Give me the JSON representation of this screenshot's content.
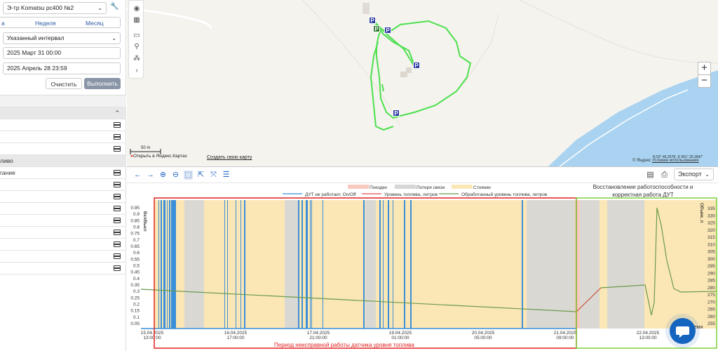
{
  "sidebar": {
    "unit_select": "Э-тр Komatsu pc400 №2",
    "tabs": [
      "а",
      "Неделя",
      "Месяц"
    ],
    "interval_select": "Указанный интервал",
    "date_from": "2025 Март 31 00:00",
    "date_to": "2025 Апрель 28 23:59",
    "clear_label": "Очистить",
    "run_label": "Выполнить",
    "rows": [
      "",
      "",
      "",
      "",
      "",
      "ливо",
      "гание",
      "",
      "",
      "",
      "",
      "",
      "",
      "",
      ""
    ]
  },
  "map": {
    "scale_label": "50 m",
    "open_yandex": "Открыть в Яндекс.Картах",
    "create_map": "Создать свою карту",
    "coords": "N 52° 46.2578', E 051° 25.3647'",
    "copyright": "© Яндекс",
    "terms": "Условия использования",
    "zoom_in": "+",
    "zoom_out": "−",
    "parking_marks": [
      "P",
      "P",
      "P",
      "P",
      "P"
    ]
  },
  "chart_toolbar": {
    "export_label": "Экспорт"
  },
  "chart_data": {
    "type": "line",
    "legend_top": [
      "Поездки",
      "Потеря связи",
      "Стоянки"
    ],
    "legend_bottom": [
      "ДУТ не работает, On/Off",
      "Уровень топлива, литров",
      "Обработанный уровень топлива, литров"
    ],
    "colors": {
      "trips": "#f7c9bf",
      "lost": "#d6d6d6",
      "stops": "#fbe7b6",
      "dut": "#3a8fd9",
      "fuel": "#6a9a4a",
      "fuel_raw": "#e05050"
    },
    "y_left_label": "Вкл/Выкл",
    "y_left_ticks": [
      "0.95",
      "0.9",
      "0.85",
      "0.8",
      "0.75",
      "0.7",
      "0.65",
      "0.6",
      "0.55",
      "0.5",
      "0.45",
      "0.4",
      "0.35",
      "0.3",
      "0.25",
      "0.2",
      "0.15",
      "0.1",
      "0.05"
    ],
    "y_right_label": "Объем, л",
    "y_right_ticks": [
      "335",
      "330",
      "325",
      "320",
      "315",
      "310",
      "305",
      "300",
      "295",
      "290",
      "285",
      "280",
      "275",
      "270",
      "265",
      "260",
      "255"
    ],
    "x_ticks": [
      {
        "date": "15.04.2025",
        "time": "13:00:00"
      },
      {
        "date": "16.04.2025",
        "time": "17:00:00"
      },
      {
        "date": "17.04.2025",
        "time": "21:00:00"
      },
      {
        "date": "19.04.2025",
        "time": "01:00:00"
      },
      {
        "date": "20.04.2025",
        "time": "05:00:00"
      },
      {
        "date": "21.04.2025",
        "time": "09:00:00"
      },
      {
        "date": "22.04.2025",
        "time": "13:00:00"
      }
    ],
    "x_axis_tail": "ремя",
    "annotation_faulty": "Период неисправной работы датчика уровня топлива",
    "annotation_recovery": [
      "Восстановление работоспособности и",
      "корректная работа ДУТ"
    ]
  }
}
